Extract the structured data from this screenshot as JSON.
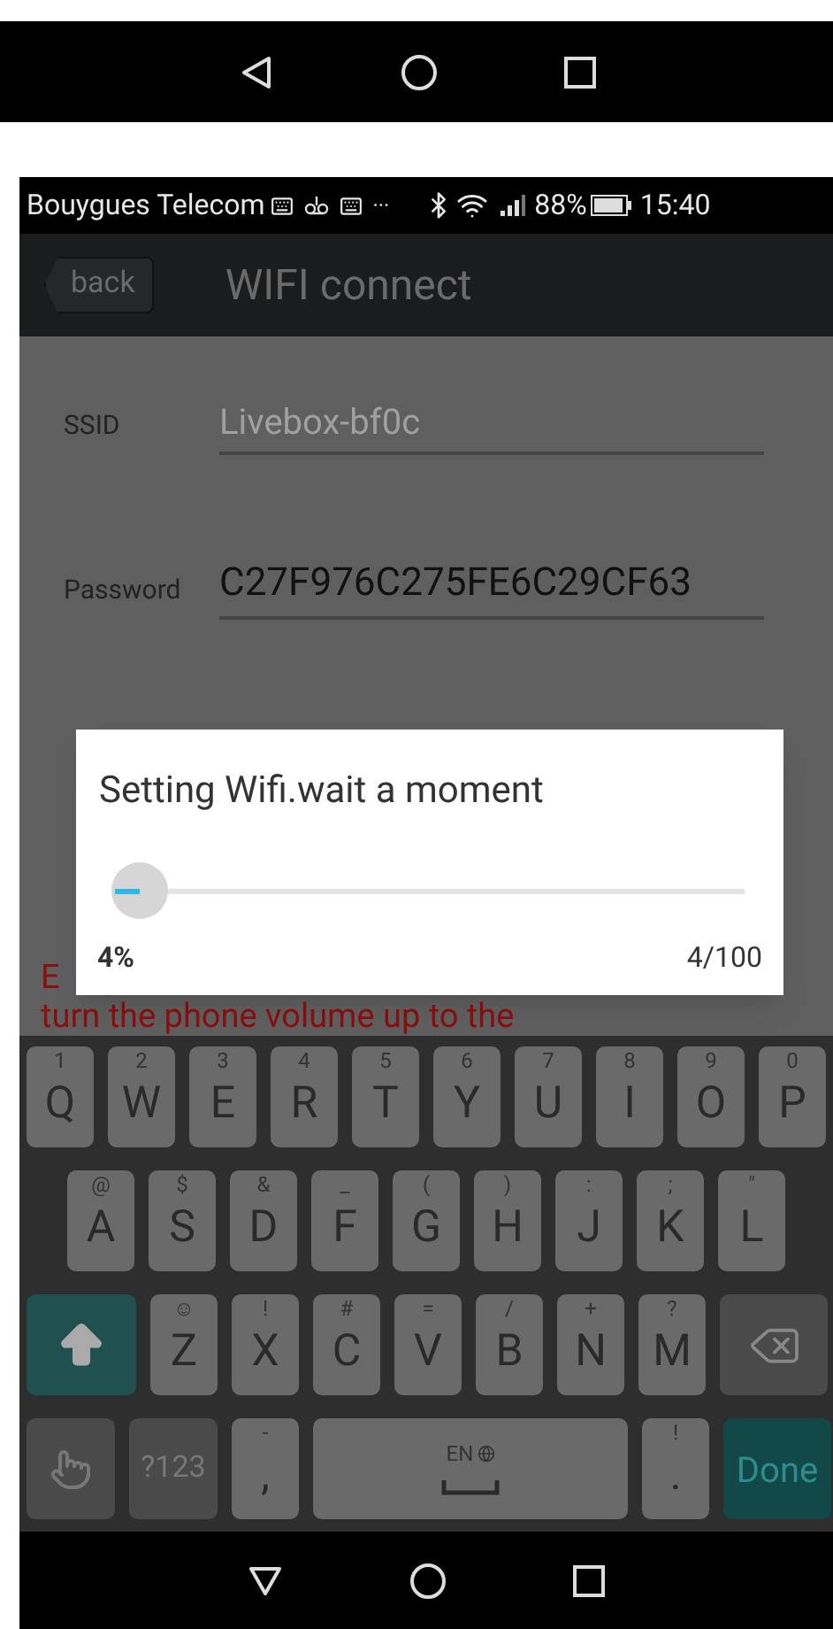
{
  "status_bar": {
    "carrier": "Bouygues Telecom",
    "overflow": "···",
    "battery": "88%",
    "time": "15:40"
  },
  "header": {
    "back": "back",
    "title": "WIFI connect"
  },
  "fields": [
    {
      "label": "SSID",
      "value": "Livebox-bf0c",
      "disabled": true
    },
    {
      "label": "Password",
      "value": "C27F976C275FE6C29CF63",
      "disabled": false
    }
  ],
  "hint": {
    "line_1": "E",
    "line_2": "turn the phone volume up to the"
  },
  "dialog": {
    "message": "Setting Wifi.wait a moment",
    "progress": {
      "level": 0.04
    },
    "percent": "4%",
    "count": "4/100"
  },
  "keyboard": [
    [
      {
        "kind": "letter",
        "label": "Q",
        "hint": "1"
      },
      {
        "kind": "letter",
        "label": "W",
        "hint": "2"
      },
      {
        "kind": "letter",
        "label": "E",
        "hint": "3"
      },
      {
        "kind": "letter",
        "label": "R",
        "hint": "4"
      },
      {
        "kind": "letter",
        "label": "T",
        "hint": "5"
      },
      {
        "kind": "letter",
        "label": "Y",
        "hint": "6"
      },
      {
        "kind": "letter",
        "label": "U",
        "hint": "7"
      },
      {
        "kind": "letter",
        "label": "I",
        "hint": "8"
      },
      {
        "kind": "letter",
        "label": "O",
        "hint": "9"
      },
      {
        "kind": "letter",
        "label": "P",
        "hint": "0"
      }
    ],
    [
      {
        "kind": "letter",
        "label": "A",
        "hint": "@"
      },
      {
        "kind": "letter",
        "label": "S",
        "hint": "$"
      },
      {
        "kind": "letter",
        "label": "D",
        "hint": "&"
      },
      {
        "kind": "letter",
        "label": "F",
        "hint": "_"
      },
      {
        "kind": "letter",
        "label": "G",
        "hint": "("
      },
      {
        "kind": "letter",
        "label": "H",
        "hint": ")"
      },
      {
        "kind": "letter",
        "label": "J",
        "hint": ":"
      },
      {
        "kind": "letter",
        "label": "K",
        "hint": ";"
      },
      {
        "kind": "letter",
        "label": "L",
        "hint": "\""
      }
    ],
    [
      {
        "kind": "shift"
      },
      {
        "kind": "letter",
        "label": "Z",
        "hint": "☺"
      },
      {
        "kind": "letter",
        "label": "X",
        "hint": "!"
      },
      {
        "kind": "letter",
        "label": "C",
        "hint": "#"
      },
      {
        "kind": "letter",
        "label": "V",
        "hint": "="
      },
      {
        "kind": "letter",
        "label": "B",
        "hint": "/"
      },
      {
        "kind": "letter",
        "label": "N",
        "hint": "+"
      },
      {
        "kind": "letter",
        "label": "M",
        "hint": "?"
      },
      {
        "kind": "backspace"
      }
    ],
    [
      {
        "kind": "gesture"
      },
      {
        "kind": "symbols",
        "label": "?123"
      },
      {
        "kind": "letter",
        "label": ",",
        "hint": "-"
      },
      {
        "kind": "space",
        "hint": "EN"
      },
      {
        "kind": "letter",
        "label": ".",
        "hint": "!"
      },
      {
        "kind": "done",
        "label": "Done"
      }
    ]
  ]
}
